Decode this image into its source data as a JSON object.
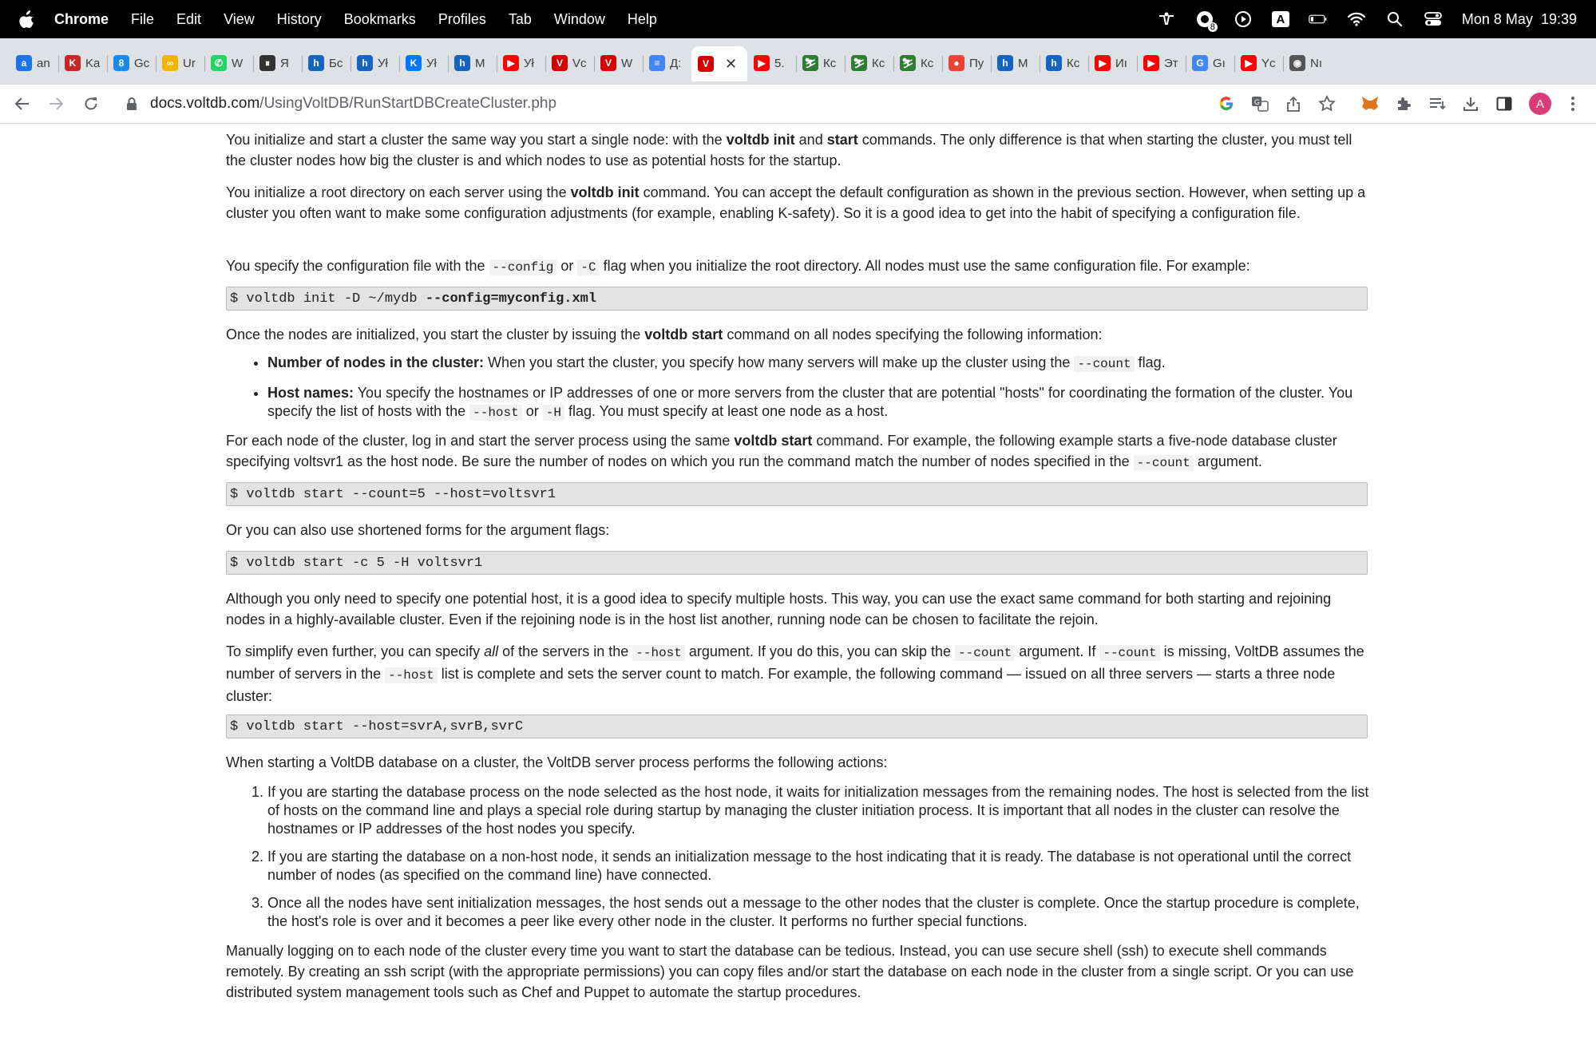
{
  "menubar": {
    "app": "Chrome",
    "items": [
      "File",
      "Edit",
      "View",
      "History",
      "Bookmarks",
      "Profiles",
      "Tab",
      "Window",
      "Help"
    ],
    "date_time": "Mon 8 May  19:39",
    "input_source": "A",
    "notification_count": "8"
  },
  "tabs": [
    {
      "icon": "amazon-icon",
      "label": "an",
      "color": "#1a73e8",
      "glyph": "a"
    },
    {
      "icon": "bookmark-icon",
      "label": "Ka",
      "color": "#c62828",
      "glyph": "K"
    },
    {
      "icon": "calendar-icon",
      "label": "Gc",
      "color": "#1e88e5",
      "glyph": "8"
    },
    {
      "icon": "infinity-icon",
      "label": "Ur",
      "color": "#f4b400",
      "glyph": "∞"
    },
    {
      "icon": "whatsapp-icon",
      "label": "W",
      "color": "#25d366",
      "glyph": "✆"
    },
    {
      "icon": "pause-icon",
      "label": "Я",
      "color": "#333333",
      "glyph": "⏸"
    },
    {
      "icon": "brand-h-icon",
      "label": "Бс",
      "color": "#1565c0",
      "glyph": "h"
    },
    {
      "icon": "brand-h-icon",
      "label": "Уł",
      "color": "#1565c0",
      "glyph": "h"
    },
    {
      "icon": "vk-icon",
      "label": "Уł",
      "color": "#0077ff",
      "glyph": "K"
    },
    {
      "icon": "brand-h-icon",
      "label": "M",
      "color": "#1565c0",
      "glyph": "h"
    },
    {
      "icon": "youtube-icon",
      "label": "Уł",
      "color": "#ff0000",
      "glyph": "▶"
    },
    {
      "icon": "voltdb-icon",
      "label": "Vc",
      "color": "#d50000",
      "glyph": "V"
    },
    {
      "icon": "voltdb-icon",
      "label": "W",
      "color": "#d50000",
      "glyph": "V"
    },
    {
      "icon": "docs-icon",
      "label": "Д:",
      "color": "#4285f4",
      "glyph": "≡"
    },
    {
      "icon": "voltdb-icon",
      "label": "",
      "color": "#d50000",
      "glyph": "V",
      "active": true
    },
    {
      "icon": "youtube-icon",
      "label": "5.",
      "color": "#ff0000",
      "glyph": "▶"
    },
    {
      "icon": "runner-icon",
      "label": "Кс",
      "color": "#2e7d32",
      "glyph": "⛷"
    },
    {
      "icon": "runner-icon",
      "label": "Кс",
      "color": "#2e7d32",
      "glyph": "⛷"
    },
    {
      "icon": "runner-icon",
      "label": "Кс",
      "color": "#2e7d32",
      "glyph": "⛷"
    },
    {
      "icon": "map-pin-icon",
      "label": "Пу",
      "color": "#ea4335",
      "glyph": "●"
    },
    {
      "icon": "brand-h-icon",
      "label": "M",
      "color": "#1565c0",
      "glyph": "h"
    },
    {
      "icon": "brand-h-icon",
      "label": "Кс",
      "color": "#1565c0",
      "glyph": "h"
    },
    {
      "icon": "youtube-icon",
      "label": "Иı",
      "color": "#ff0000",
      "glyph": "▶"
    },
    {
      "icon": "youtube-icon",
      "label": "Эт",
      "color": "#ff0000",
      "glyph": "▶"
    },
    {
      "icon": "translate-icon",
      "label": "Gı",
      "color": "#4285f4",
      "glyph": "G"
    },
    {
      "icon": "youtube-icon",
      "label": "Yc",
      "color": "#ff0000",
      "glyph": "▶"
    },
    {
      "icon": "chrome-icon",
      "label": "Nı",
      "color": "#555555",
      "glyph": "◉"
    }
  ],
  "address_bar": {
    "host": "docs.voltdb.com",
    "path": "/UsingVoltDB/RunStartDBCreateCluster.php"
  },
  "profile_initial": "A",
  "doc": {
    "p1": [
      {
        "t": "You initialize and start a cluster the same way you start a single node: with the "
      },
      {
        "t": "voltdb init",
        "b": true
      },
      {
        "t": " and "
      },
      {
        "t": "start",
        "b": true
      },
      {
        "t": " commands. The only difference is that when starting the cluster, you must tell the cluster nodes how big the cluster is and which nodes to use as potential hosts for the startup."
      }
    ],
    "p2": [
      {
        "t": "You initialize a root directory on each server using the "
      },
      {
        "t": "voltdb init",
        "b": true
      },
      {
        "t": " command. You can accept the default configuration as shown in the previous section. However, when setting up a cluster you often want to make some configuration adjustments (for example, enabling K-safety). So it is a good idea to get into the habit of specifying a configuration file."
      }
    ],
    "p3": [
      {
        "t": "You specify the configuration file with the "
      },
      {
        "t": "--config",
        "c": true
      },
      {
        "t": " or "
      },
      {
        "t": "-C",
        "c": true
      },
      {
        "t": " flag when you initialize the root directory. All nodes must use the same configuration file. For example:"
      }
    ],
    "code1": [
      {
        "t": "$ voltdb init -D ~/mydb "
      },
      {
        "t": "--config=myconfig.xml",
        "b": true
      }
    ],
    "p4": [
      {
        "t": "Once the nodes are initialized, you start the cluster by issuing the "
      },
      {
        "t": "voltdb start",
        "b": true
      },
      {
        "t": " command on all nodes specifying the following information:"
      }
    ],
    "bullets": [
      [
        {
          "t": "Number of nodes in the cluster:",
          "b": true
        },
        {
          "t": " When you start the cluster, you specify how many servers will make up the cluster using the "
        },
        {
          "t": "--count",
          "c": true
        },
        {
          "t": " flag."
        }
      ],
      [
        {
          "t": "Host names:",
          "b": true
        },
        {
          "t": " You specify the hostnames or IP addresses of one or more servers from the cluster that are potential \"hosts\" for coordinating the formation of the cluster. You specify the list of hosts with the "
        },
        {
          "t": "--host",
          "c": true
        },
        {
          "t": " or "
        },
        {
          "t": "-H",
          "c": true
        },
        {
          "t": " flag. You must specify at least one node as a host."
        }
      ]
    ],
    "p5": [
      {
        "t": "For each node of the cluster, log in and start the server process using the same "
      },
      {
        "t": "voltdb start",
        "b": true
      },
      {
        "t": " command. For example, the following example starts a five-node database cluster specifying voltsvr1 as the host node. Be sure the number of nodes on which you run the command match the number of nodes specified in the "
      },
      {
        "t": "--count",
        "c": true
      },
      {
        "t": " argument."
      }
    ],
    "code2": [
      {
        "t": "$ voltdb start --count=5 --host=voltsvr1"
      }
    ],
    "p6": [
      {
        "t": "Or you can also use shortened forms for the argument flags:"
      }
    ],
    "code3": [
      {
        "t": "$ voltdb start -c 5 -H voltsvr1"
      }
    ],
    "p7": [
      {
        "t": "Although you only need to specify one potential host, it is a good idea to specify multiple hosts. This way, you can use the exact same command for both starting and rejoining nodes in a highly-available cluster. Even if the rejoining node is in the host list another, running node can be chosen to facilitate the rejoin."
      }
    ],
    "p8": [
      {
        "t": "To simplify even further, you can specify "
      },
      {
        "t": "all",
        "i": true
      },
      {
        "t": " of the servers in the "
      },
      {
        "t": "--host",
        "c": true
      },
      {
        "t": " argument. If you do this, you can skip the "
      },
      {
        "t": "--count",
        "c": true
      },
      {
        "t": " argument. If "
      },
      {
        "t": "--count",
        "c": true
      },
      {
        "t": " is missing, VoltDB assumes the number of servers in the "
      },
      {
        "t": "--host",
        "c": true
      },
      {
        "t": " list is complete and sets the server count to match. For example, the following command — issued on all three servers — starts a three node cluster:"
      }
    ],
    "code4": [
      {
        "t": "$ voltdb start --host=svrA,svrB,svrC"
      }
    ],
    "p9": [
      {
        "t": "When starting a VoltDB database on a cluster, the VoltDB server process performs the following actions:"
      }
    ],
    "steps": [
      [
        {
          "t": "If you are starting the database process on the node selected as the host node, it waits for initialization messages from the remaining nodes. The host is selected from the list of hosts on the command line and plays a special role during startup by managing the cluster initiation process. It is important that all nodes in the cluster can resolve the hostnames or IP addresses of the host nodes you specify."
        }
      ],
      [
        {
          "t": "If you are starting the database on a non-host node, it sends an initialization message to the host indicating that it is ready. The database is not operational until the correct number of nodes (as specified on the command line) have connected."
        }
      ],
      [
        {
          "t": "Once all the nodes have sent initialization messages, the host sends out a message to the other nodes that the cluster is complete. Once the startup procedure is complete, the host's role is over and it becomes a peer like every other node in the cluster. It performs no further special functions."
        }
      ]
    ],
    "p10": [
      {
        "t": "Manually logging on to each node of the cluster every time you want to start the database can be tedious. Instead, you can use secure shell (ssh) to execute shell commands remotely. By creating an ssh script (with the appropriate permissions) you can copy files and/or start the database on each node in the cluster from a single script. Or you can use distributed system management tools such as Chef and Puppet to automate the startup procedures."
      }
    ]
  }
}
